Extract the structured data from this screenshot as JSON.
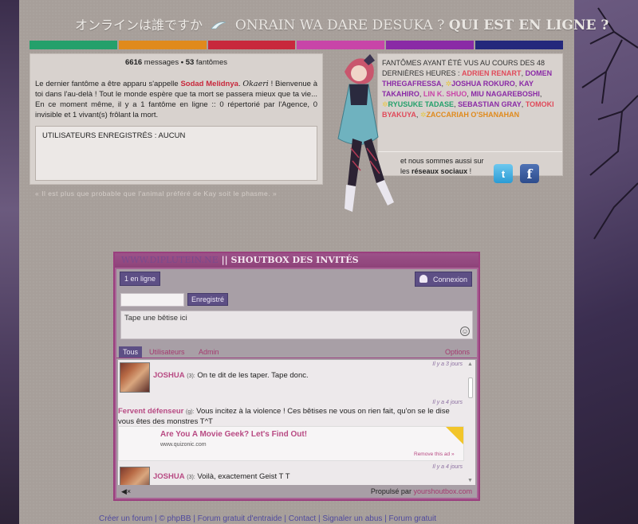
{
  "banner": {
    "jp": "オンラインは誰ですか",
    "romaji": "ONRAIN WA DARE DESUKA ?",
    "fr": "QUI EST EN LIGNE ?"
  },
  "colorbar": [
    "#24a06b",
    "#e08a1c",
    "#c8283c",
    "#c845a8",
    "#8a2aa6",
    "#24287c"
  ],
  "stats": {
    "messages_count": "6616",
    "messages_label": "messages",
    "sep": "•",
    "ghosts_count": "53",
    "ghosts_label": "fantômes",
    "latest_prefix": "Le dernier fantôme a être apparu s'appelle",
    "latest_name": "Sodad Melidnya",
    "okaeri": "Okaeri",
    "body": "! Bienvenue à toi dans l'au-delà ! Tout le monde espère que ta mort se passera mieux que ta vie... En ce moment même, il y a 1 fantôme en ligne :: 0 répertorié par l'Agence, 0 invisible et 1 vivant(s) frôlant la mort.",
    "registered_users": "UTILISATEURS ENREGISTRÉS : AUCUN"
  },
  "quote": "« Il est plus que probable que l'animal préféré de Kay soit le phasme. »",
  "ghosts48": {
    "heading": "FANTÔMES AYANT ÉTÉ VUS AU COURS DES 48 DERNIÈRES HEURES :",
    "names": [
      {
        "name": "ADRIEN RENART",
        "color": "#e04a5a",
        "star": false
      },
      {
        "name": "DOMEN THREGAFRESSA",
        "color": "#8a2aa6",
        "star": false
      },
      {
        "name": "JOSHUA ROKURO",
        "color": "#8a2aa6",
        "star": true
      },
      {
        "name": "KAY TAKAHIRO",
        "color": "#8a2aa6",
        "star": false
      },
      {
        "name": "LIN K. SHUO",
        "color": "#c845a8",
        "star": false
      },
      {
        "name": "MIU NAGAREBOSHI",
        "color": "#8a2aa6",
        "star": false
      },
      {
        "name": "RYUSUKE TADASE",
        "color": "#24a06b",
        "star": true
      },
      {
        "name": "SEBASTIAN GRAY",
        "color": "#8a2aa6",
        "star": false
      },
      {
        "name": "TOMOKI BYAKUYA",
        "color": "#e04a5a",
        "star": false
      },
      {
        "name": "ZACCARIAH O'SHANAHAN",
        "color": "#e08a1c",
        "star": true
      }
    ],
    "social_text_a": "et nous sommes aussi sur",
    "social_text_b": "les",
    "social_bold": "réseaux sociaux",
    "social_end": "!"
  },
  "shoutbox": {
    "site": "WWW.DIPLUTEIN.NE",
    "sep": "||",
    "title": "SHOUTBOX DES INVITÉS",
    "online": "1 en ligne",
    "login": "Connexion",
    "registered_btn": "Enregistré",
    "message_placeholder": "Tape une bêtise ici",
    "tabs": [
      "Tous",
      "Utilisateurs",
      "Admin"
    ],
    "options": "Options",
    "messages": [
      {
        "user": "JOSHUA",
        "level": "(3):",
        "text": "On te dit de les taper. Tape donc.",
        "time": "Il y a 3 jours"
      },
      {
        "user": "Fervent défenseur",
        "level": "(g):",
        "text": "Vous incitez à la violence ! Ces bêtises ne vous on rien fait, qu'on se le dise vous êtes des monstres T^T",
        "time": "Il y a 4 jours"
      },
      {
        "user": "JOSHUA",
        "level": "(3):",
        "text": "Voilà, exactement Geist T            T",
        "time": "Il y a 4 jours"
      }
    ],
    "ad": {
      "title": "Are You A Movie Geek? Let's Find Out!",
      "url": "www.quizonic.com",
      "remove": "Remove this ad »"
    },
    "powered_prefix": "Propulsé par",
    "powered_link": "yourshoutbox.com"
  },
  "footer": "Créer un forum | © phpBB | Forum gratuit d'entraide | Contact | Signaler un abus | Forum gratuit"
}
